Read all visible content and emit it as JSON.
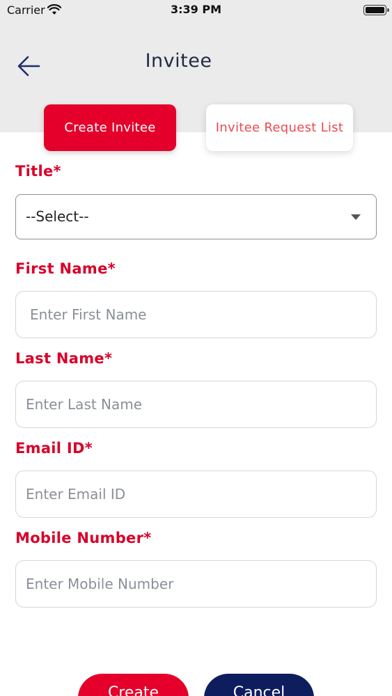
{
  "status_bar": {
    "carrier": "Carrier",
    "time": "3:39 PM"
  },
  "header": {
    "title": "Invitee",
    "back_icon": "arrow-left-icon"
  },
  "tabs": [
    {
      "label": "Create Invitee",
      "active": true
    },
    {
      "label": "Invitee Request List",
      "active": false
    }
  ],
  "form": {
    "title": {
      "label": "Title*",
      "value": "--Select--"
    },
    "first_name": {
      "label": "First Name*",
      "placeholder": "Enter First Name"
    },
    "last_name": {
      "label": "Last Name*",
      "placeholder": "Enter Last Name"
    },
    "email": {
      "label": "Email ID*",
      "placeholder": "Enter Email ID"
    },
    "mobile": {
      "label": "Mobile Number*",
      "placeholder": "Enter Mobile Number"
    }
  },
  "actions": {
    "create_label": "Create",
    "cancel_label": "Cancel"
  },
  "colors": {
    "accent_red": "#e4002b",
    "navy": "#0d1d5e",
    "header_bg": "#ebebeb"
  }
}
